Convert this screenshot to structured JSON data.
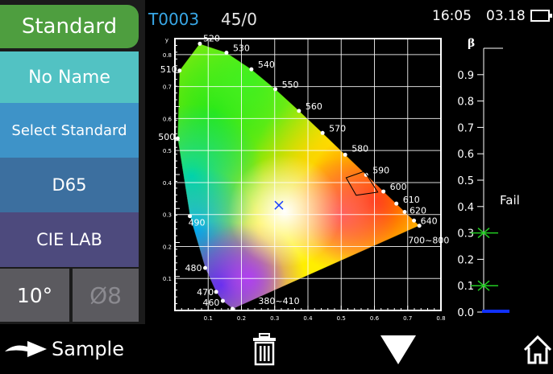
{
  "sidebar": {
    "standard_label": "Standard",
    "name_label": "No Name",
    "select_label": "Select Standard",
    "illuminant_label": "D65",
    "color_space_label": "CIE LAB",
    "observer_label": "10°",
    "aperture_label": "Ø8"
  },
  "status": {
    "record_id": "T0003",
    "geometry": "45/0",
    "time": "16:05",
    "date": "03.18",
    "battery_icon": "battery-icon"
  },
  "chart_data": {
    "type": "scatter",
    "title": "",
    "xlabel": "",
    "ylabel": "y",
    "x_ticks": [
      "0.1",
      "0.2",
      "0.3",
      "0.4",
      "0.5",
      "0.6",
      "0.7",
      "0.8"
    ],
    "y_ticks": [
      "0.1",
      "0.2",
      "0.3",
      "0.4",
      "0.5",
      "0.6",
      "0.7",
      "0.8"
    ],
    "xlim": [
      0,
      0.8
    ],
    "ylim": [
      0,
      0.85
    ],
    "wavelength_labels": [
      {
        "text": "520",
        "x": 0.075,
        "y": 0.834
      },
      {
        "text": "530",
        "x": 0.155,
        "y": 0.806
      },
      {
        "text": "540",
        "x": 0.23,
        "y": 0.754
      },
      {
        "text": "550",
        "x": 0.302,
        "y": 0.692
      },
      {
        "text": "560",
        "x": 0.373,
        "y": 0.624
      },
      {
        "text": "570",
        "x": 0.444,
        "y": 0.555
      },
      {
        "text": "580",
        "x": 0.512,
        "y": 0.487
      },
      {
        "text": "590",
        "x": 0.575,
        "y": 0.424
      },
      {
        "text": "600",
        "x": 0.627,
        "y": 0.372
      },
      {
        "text": "610",
        "x": 0.666,
        "y": 0.334
      },
      {
        "text": "620",
        "x": 0.691,
        "y": 0.308
      },
      {
        "text": "640",
        "x": 0.719,
        "y": 0.281
      },
      {
        "text": "700~800",
        "x": 0.735,
        "y": 0.265
      },
      {
        "text": "510",
        "x": 0.014,
        "y": 0.75
      },
      {
        "text": "500",
        "x": 0.008,
        "y": 0.538
      },
      {
        "text": "490",
        "x": 0.045,
        "y": 0.295
      },
      {
        "text": "480",
        "x": 0.091,
        "y": 0.133
      },
      {
        "text": "470",
        "x": 0.124,
        "y": 0.058
      },
      {
        "text": "460",
        "x": 0.144,
        "y": 0.03
      },
      {
        "text": "380~410",
        "x": 0.173,
        "y": 0.005
      }
    ],
    "sample_point": {
      "x": 0.3127,
      "y": 0.329,
      "marker": "x"
    },
    "tolerance_polygon": [
      [
        0.515,
        0.415
      ],
      [
        0.57,
        0.435
      ],
      [
        0.61,
        0.37
      ],
      [
        0.545,
        0.36
      ]
    ],
    "grid": true
  },
  "beta_scale": {
    "label": "β",
    "ticks": [
      "0.9",
      "0.8",
      "0.7",
      "0.6",
      "0.5",
      "0.4",
      "0.3",
      "0.2",
      "0.1",
      "0.0"
    ],
    "range": [
      0,
      1
    ],
    "markers": [
      0.3,
      0.1
    ],
    "current": 0.0,
    "verdict": "Fail",
    "marker_color": "#22cc22",
    "current_color": "#1030ff"
  },
  "bottombar": {
    "sample_label": "Sample",
    "arrow_icon": "arrow-right-icon",
    "delete_icon": "trash-icon",
    "down_icon": "triangle-down-icon",
    "home_icon": "home-icon"
  },
  "colors": {
    "standard_tab": "#4e9e3f",
    "name_tab": "#52c2c3",
    "select_tab": "#3e93c8",
    "illuminant_tab": "#3c6f9f",
    "colorspace_tab": "#4d4a7d",
    "id_text": "#38a7e6"
  }
}
